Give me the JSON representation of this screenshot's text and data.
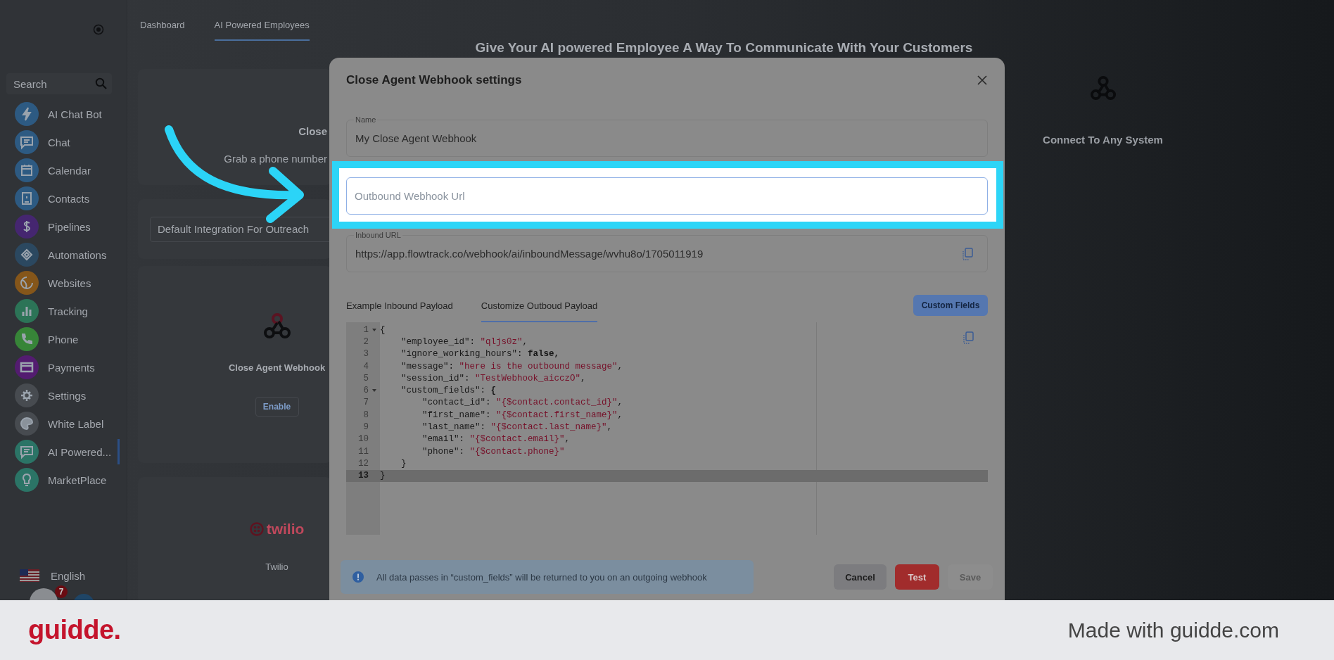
{
  "sidebar": {
    "search": {
      "placeholder": "Search"
    },
    "items": [
      {
        "label": "AI Chat Bot",
        "color": "#2d5a82",
        "selected": false
      },
      {
        "label": "Chat",
        "color": "#2d5a82",
        "selected": false
      },
      {
        "label": "Calendar",
        "color": "#2d5a82",
        "selected": false
      },
      {
        "label": "Contacts",
        "color": "#2d5a82",
        "selected": false
      },
      {
        "label": "Pipelines",
        "color": "#452670",
        "selected": false
      },
      {
        "label": "Automations",
        "color": "#2b4860",
        "selected": false
      },
      {
        "label": "Websites",
        "color": "#85561a",
        "selected": false
      },
      {
        "label": "Tracking",
        "color": "#2c7457",
        "selected": false
      },
      {
        "label": "Phone",
        "color": "#378538",
        "selected": false
      },
      {
        "label": "Payments",
        "color": "#531c70",
        "selected": false
      },
      {
        "label": "Settings",
        "color": "#474b50",
        "selected": false
      },
      {
        "label": "White Label",
        "color": "#474b50",
        "selected": false
      },
      {
        "label": "AI Powered...",
        "color": "#2b7466",
        "selected": true
      },
      {
        "label": "MarketPlace",
        "color": "#2b7466",
        "selected": false
      }
    ],
    "language": "English",
    "badge": "7"
  },
  "top_tabs": [
    {
      "label": "Dashboard",
      "selected": false
    },
    {
      "label": "AI Powered Employees",
      "selected": true
    }
  ],
  "heading": "Give Your AI powered Employee A Way To Communicate With Your Customers",
  "cards": [
    {
      "title": "Close",
      "subtitle": "Grab a phone number"
    },
    {
      "field": "Default Integration For Outreach"
    },
    {
      "title": "Close Agent Webhook",
      "button": "Enable"
    },
    {
      "logo": "twilio",
      "title": "Twilio"
    }
  ],
  "right_card": {
    "title": "Connect To Any System"
  },
  "modal": {
    "title": "Close Agent Webhook settings",
    "name_field": {
      "label": "Name",
      "value": "My Close Agent Webhook"
    },
    "outbound_field": {
      "placeholder": "Outbound Webhook Url"
    },
    "inbound_field": {
      "label": "Inbound URL",
      "value": "https://app.flowtrack.co/webhook/ai/inboundMessage/wvhu8o/1705011919"
    },
    "tabs": [
      {
        "label": "Example Inbound Payload",
        "selected": false
      },
      {
        "label": "Customize Outboud Payload",
        "selected": true
      }
    ],
    "custom_fields_button": "Custom Fields",
    "code": [
      {
        "num": "1",
        "text": "{",
        "fold": true,
        "active": false
      },
      {
        "num": "2",
        "text": "    \"employee_id\": \"qljs0z\",",
        "fold": false,
        "active": false
      },
      {
        "num": "3",
        "text": "    \"ignore_working_hours\": false,",
        "fold": false,
        "active": false
      },
      {
        "num": "4",
        "text": "    \"message\": \"here is the outbound message\",",
        "fold": false,
        "active": false
      },
      {
        "num": "5",
        "text": "    \"session_id\": \"TestWebhook_aicczO\",",
        "fold": false,
        "active": false
      },
      {
        "num": "6",
        "text": "    \"custom_fields\": {",
        "fold": true,
        "active": false
      },
      {
        "num": "7",
        "text": "        \"contact_id\": \"{$contact.contact_id}\",",
        "fold": false,
        "active": false
      },
      {
        "num": "8",
        "text": "        \"first_name\": \"{$contact.first_name}\",",
        "fold": false,
        "active": false
      },
      {
        "num": "9",
        "text": "        \"last_name\": \"{$contact.last_name}\",",
        "fold": false,
        "active": false
      },
      {
        "num": "10",
        "text": "        \"email\": \"{$contact.email}\",",
        "fold": false,
        "active": false
      },
      {
        "num": "11",
        "text": "        \"phone\": \"{$contact.phone}\"",
        "fold": false,
        "active": false
      },
      {
        "num": "12",
        "text": "    }",
        "fold": false,
        "active": false
      },
      {
        "num": "13",
        "text": "}",
        "fold": false,
        "active": true
      }
    ],
    "info": "All data passes in “custom_fields” will be returned to you on an outgoing webhook",
    "buttons": [
      {
        "label": "Cancel",
        "kind": "secondary",
        "disabled": false
      },
      {
        "label": "Test",
        "kind": "danger",
        "disabled": false
      },
      {
        "label": "Save",
        "kind": "primary",
        "disabled": true
      }
    ]
  },
  "footer": {
    "logo": "guidde.",
    "text": "Made with guidde.com"
  }
}
